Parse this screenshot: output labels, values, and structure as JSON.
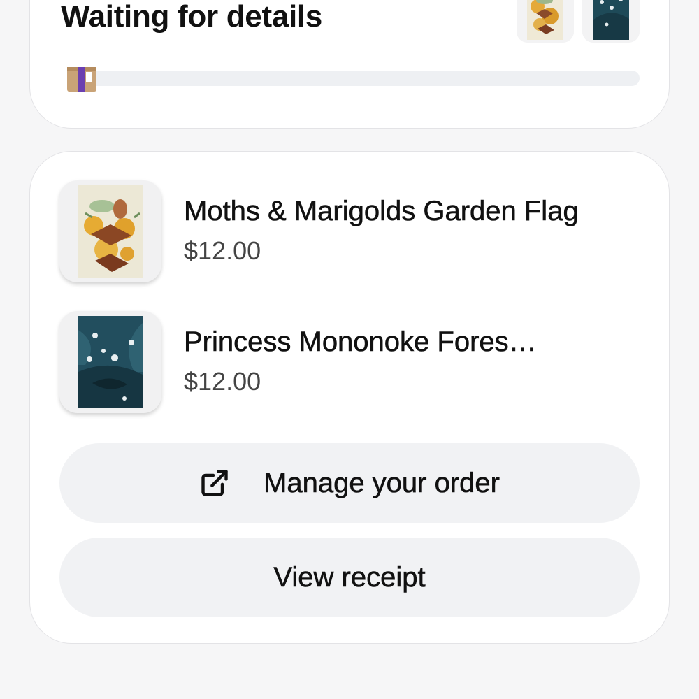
{
  "status": {
    "title": "Waiting for details"
  },
  "items": [
    {
      "name": "Moths & Marigolds Garden Flag",
      "price": "$12.00"
    },
    {
      "name": "Princess Mononoke Fores…",
      "price": "$12.00"
    }
  ],
  "actions": {
    "manage_label": "Manage your order",
    "receipt_label": "View receipt"
  },
  "colors": {
    "page_background": "#f6f6f7",
    "card_background": "#ffffff",
    "button_background": "#f1f2f4",
    "progress_track": "#eef0f3",
    "box_icon_purple": "#6b3fb0"
  },
  "icons": {
    "shipping_box": "package-box-icon",
    "manage": "external-link-icon"
  }
}
